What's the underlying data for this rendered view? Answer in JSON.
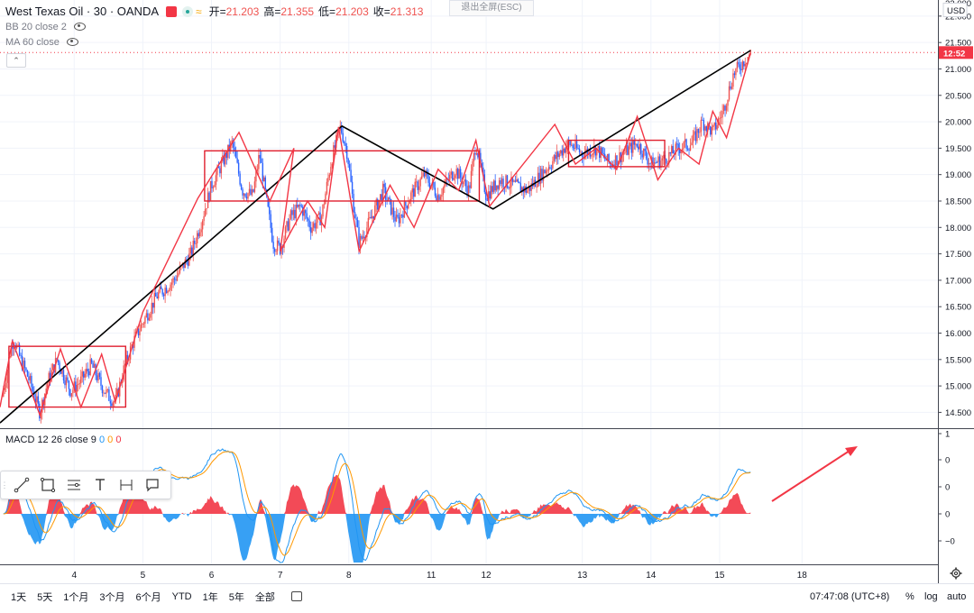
{
  "header": {
    "symbol": "West Texas Oil · 30 · OANDA",
    "ohlc": {
      "open_label": "开=",
      "open": "21.203",
      "high_label": "高=",
      "high": "21.355",
      "low_label": "低=",
      "low": "21.203",
      "close_label": "收=",
      "close": "21.313"
    },
    "indicators": [
      "BB 20 close 2",
      "MA 60 close"
    ],
    "exit_fullscreen": "退出全屏(ESC)"
  },
  "price_axis": {
    "currency": "USD",
    "ticks": [
      14.5,
      15.0,
      15.5,
      16.0,
      16.5,
      17.0,
      17.5,
      18.0,
      18.5,
      19.0,
      19.5,
      20.0,
      20.5,
      21.0,
      21.5,
      22.0
    ],
    "top_tick_label": "22.000",
    "countdown": "12:52",
    "current_price": 21.31
  },
  "time_axis": {
    "labels": [
      {
        "label": "4",
        "x": 4
      },
      {
        "label": "5",
        "x": 5
      },
      {
        "label": "6",
        "x": 6
      },
      {
        "label": "7",
        "x": 7
      },
      {
        "label": "8",
        "x": 8
      },
      {
        "label": "11",
        "x": 9.2
      },
      {
        "label": "12",
        "x": 10.0
      },
      {
        "label": "13",
        "x": 11.4
      },
      {
        "label": "14",
        "x": 12.4
      },
      {
        "label": "15",
        "x": 13.4
      },
      {
        "label": "18",
        "x": 14.6
      }
    ]
  },
  "macd": {
    "label": "MACD 12 26 close 9",
    "values": [
      "0",
      "0",
      "0"
    ],
    "axis_labels": [
      "1",
      "0",
      "0",
      "0",
      "−0"
    ],
    "colors": {
      "macd": "#2196f3",
      "signal": "#ff9800",
      "hist_pos": "#f23645",
      "hist_neg": "#2196f3"
    }
  },
  "bottom_bar": {
    "timeframes": [
      "1天",
      "5天",
      "1个月",
      "3个月",
      "6个月",
      "YTD",
      "1年",
      "5年",
      "全部"
    ],
    "clock": "07:47:08 (UTC+8)",
    "pct": "%",
    "log": "log",
    "auto": "auto"
  },
  "toolbar": {
    "tools": [
      "trend-line-icon",
      "rectangle-icon",
      "fib-lines-icon",
      "text-icon",
      "measure-icon",
      "callout-icon"
    ]
  },
  "chart_data": {
    "type": "candlestick",
    "ylim": [
      14.2,
      22.1
    ],
    "xlim": [
      2.92,
      15.2
    ],
    "price_path": [
      [
        2.95,
        14.8
      ],
      [
        3.0,
        15.1
      ],
      [
        3.06,
        15.6
      ],
      [
        3.12,
        15.9
      ],
      [
        3.22,
        15.5
      ],
      [
        3.35,
        15.1
      ],
      [
        3.5,
        14.5
      ],
      [
        3.62,
        15.1
      ],
      [
        3.75,
        15.5
      ],
      [
        3.85,
        15.2
      ],
      [
        3.95,
        14.9
      ],
      [
        4.1,
        15.1
      ],
      [
        4.25,
        15.4
      ],
      [
        4.4,
        15.0
      ],
      [
        4.5,
        14.8
      ],
      [
        4.6,
        14.7
      ],
      [
        4.72,
        15.3
      ],
      [
        4.85,
        15.8
      ],
      [
        5.0,
        16.2
      ],
      [
        5.2,
        16.7
      ],
      [
        5.45,
        17.0
      ],
      [
        5.7,
        17.5
      ],
      [
        5.85,
        18.1
      ],
      [
        6.0,
        18.8
      ],
      [
        6.15,
        19.2
      ],
      [
        6.3,
        19.6
      ],
      [
        6.45,
        18.7
      ],
      [
        6.6,
        18.6
      ],
      [
        6.7,
        19.4
      ],
      [
        6.8,
        18.5
      ],
      [
        6.9,
        17.7
      ],
      [
        7.0,
        17.6
      ],
      [
        7.15,
        18.2
      ],
      [
        7.3,
        18.4
      ],
      [
        7.45,
        18.0
      ],
      [
        7.6,
        18.2
      ],
      [
        7.75,
        19.3
      ],
      [
        7.88,
        19.9
      ],
      [
        7.98,
        19.4
      ],
      [
        8.05,
        18.6
      ],
      [
        8.15,
        17.7
      ],
      [
        8.3,
        18.1
      ],
      [
        8.5,
        18.7
      ],
      [
        8.7,
        18.1
      ],
      [
        8.9,
        18.6
      ],
      [
        9.1,
        19.0
      ],
      [
        9.3,
        18.6
      ],
      [
        9.55,
        19.1
      ],
      [
        9.75,
        18.7
      ],
      [
        9.85,
        19.6
      ],
      [
        10.0,
        18.6
      ],
      [
        10.2,
        18.9
      ],
      [
        10.4,
        18.8
      ],
      [
        10.6,
        18.7
      ],
      [
        10.8,
        19.0
      ],
      [
        11.0,
        19.3
      ],
      [
        11.2,
        19.6
      ],
      [
        11.4,
        19.4
      ],
      [
        11.6,
        19.5
      ],
      [
        11.8,
        19.2
      ],
      [
        12.0,
        19.4
      ],
      [
        12.2,
        19.6
      ],
      [
        12.4,
        19.2
      ],
      [
        12.6,
        19.3
      ],
      [
        12.8,
        19.5
      ],
      [
        13.0,
        19.6
      ],
      [
        13.15,
        20.0
      ],
      [
        13.3,
        19.8
      ],
      [
        13.45,
        20.2
      ],
      [
        13.6,
        20.9
      ],
      [
        13.75,
        21.15
      ],
      [
        13.85,
        21.3
      ]
    ],
    "trendlines": [
      {
        "name": "black-zigzag",
        "color": "#000000",
        "points": [
          [
            2.92,
            14.3
          ],
          [
            7.9,
            19.92
          ],
          [
            10.1,
            18.35
          ],
          [
            13.85,
            21.35
          ]
        ]
      },
      {
        "name": "red-zigzag",
        "color": "#f23645",
        "points": [
          [
            2.92,
            14.6
          ],
          [
            3.1,
            15.85
          ],
          [
            3.5,
            14.45
          ],
          [
            3.8,
            15.7
          ],
          [
            4.1,
            14.6
          ],
          [
            4.4,
            15.6
          ],
          [
            4.6,
            14.7
          ],
          [
            5.0,
            16.4
          ],
          [
            5.8,
            18.55
          ],
          [
            6.4,
            19.8
          ],
          [
            6.85,
            18.5
          ],
          [
            7.2,
            19.5
          ],
          [
            7.0,
            17.55
          ],
          [
            7.4,
            18.5
          ],
          [
            7.65,
            18.0
          ],
          [
            7.85,
            19.9
          ],
          [
            8.15,
            17.55
          ],
          [
            8.6,
            18.8
          ],
          [
            8.95,
            18.0
          ],
          [
            9.3,
            19.1
          ],
          [
            9.6,
            18.7
          ],
          [
            9.85,
            19.65
          ],
          [
            10.05,
            18.4
          ],
          [
            11.0,
            19.95
          ],
          [
            11.3,
            19.2
          ],
          [
            11.6,
            19.5
          ],
          [
            11.9,
            19.1
          ],
          [
            12.2,
            20.1
          ],
          [
            12.5,
            18.9
          ],
          [
            12.8,
            19.5
          ],
          [
            13.1,
            19.2
          ],
          [
            13.3,
            20.2
          ],
          [
            13.5,
            19.7
          ],
          [
            13.85,
            21.3
          ]
        ]
      }
    ],
    "rectangles": [
      {
        "name": "range-box-1",
        "x1": 3.05,
        "x2": 4.75,
        "y1": 14.6,
        "y2": 15.75
      },
      {
        "name": "range-box-2",
        "x1": 5.9,
        "x2": 9.9,
        "y1": 18.5,
        "y2": 19.45
      },
      {
        "name": "range-box-3",
        "x1": 11.2,
        "x2": 12.6,
        "y1": 19.15,
        "y2": 19.65
      }
    ],
    "annotations": [
      {
        "name": "macd-up-arrow",
        "type": "arrow",
        "pane": "macd",
        "color": "#f23645"
      }
    ]
  }
}
